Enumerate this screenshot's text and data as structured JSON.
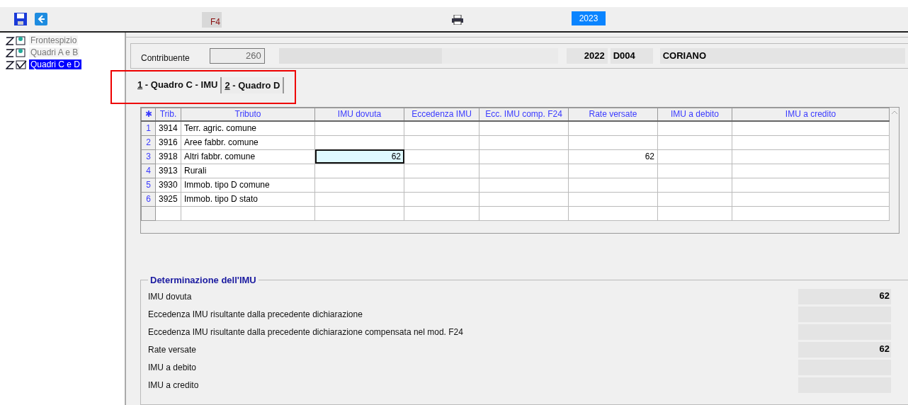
{
  "toolbar": {
    "shortcut_key": "F4",
    "year": "2023"
  },
  "sidebar": {
    "items": [
      {
        "label": "Frontespizio",
        "kind": "pending",
        "selected": false
      },
      {
        "label": "Quadri A e B",
        "kind": "pending",
        "selected": false
      },
      {
        "label": "Quadri C e D",
        "kind": "done",
        "selected": true
      }
    ]
  },
  "header": {
    "contribuente_label": "Contribuente",
    "contribuente_value": "260",
    "year": "2022",
    "code": "D004",
    "municipality": "CORIANO"
  },
  "tabs": [
    {
      "key": "1",
      "label": " - Quadro C - IMU",
      "selected": true
    },
    {
      "key": "2",
      "label": " - Quadro D",
      "selected": false
    }
  ],
  "table": {
    "corner": "✱",
    "columns": [
      "Trib.",
      "Tributo",
      "IMU dovuta",
      "Eccedenza IMU",
      "Ecc. IMU comp. F24",
      "Rate versate",
      "IMU a debito",
      "IMU a credito"
    ],
    "rows": [
      {
        "num": "1",
        "cells": [
          {
            "value": "3914",
            "selected": false
          },
          {
            "value": "Terr. agric. comune",
            "selected": false
          },
          {
            "selected": false
          },
          {
            "selected": false
          },
          {
            "selected": false
          },
          {
            "selected": false
          },
          {
            "selected": false
          },
          {
            "selected": false
          }
        ]
      },
      {
        "num": "2",
        "cells": [
          {
            "value": "3916",
            "selected": false
          },
          {
            "value": "Aree fabbr. comune",
            "selected": false
          },
          {
            "selected": false
          },
          {
            "selected": false
          },
          {
            "selected": false
          },
          {
            "selected": false
          },
          {
            "selected": false
          },
          {
            "selected": false
          }
        ]
      },
      {
        "num": "3",
        "cells": [
          {
            "value": "3918",
            "selected": false
          },
          {
            "value": "Altri fabbr. comune",
            "selected": false
          },
          {
            "value": "62",
            "selected": true
          },
          {
            "selected": false
          },
          {
            "selected": false
          },
          {
            "value": "62",
            "selected": false
          },
          {
            "selected": false
          },
          {
            "selected": false
          }
        ]
      },
      {
        "num": "4",
        "cells": [
          {
            "value": "3913",
            "selected": false
          },
          {
            "value": "Rurali",
            "selected": false
          },
          {
            "selected": false
          },
          {
            "selected": false
          },
          {
            "selected": false
          },
          {
            "selected": false
          },
          {
            "selected": false
          },
          {
            "selected": false
          }
        ]
      },
      {
        "num": "5",
        "cells": [
          {
            "value": "3930",
            "selected": false
          },
          {
            "value": "Immob. tipo D comune",
            "selected": false
          },
          {
            "selected": false
          },
          {
            "selected": false
          },
          {
            "selected": false
          },
          {
            "selected": false
          },
          {
            "selected": false
          },
          {
            "selected": false
          }
        ]
      },
      {
        "num": "6",
        "cells": [
          {
            "value": "3925",
            "selected": false
          },
          {
            "value": "Immob. tipo D stato",
            "selected": false
          },
          {
            "selected": false
          },
          {
            "selected": false
          },
          {
            "selected": false
          },
          {
            "selected": false
          },
          {
            "selected": false
          },
          {
            "selected": false
          }
        ]
      },
      {
        "cells": [
          {
            "selected": false
          },
          {
            "selected": false
          },
          {
            "selected": false
          },
          {
            "selected": false
          },
          {
            "selected": false
          },
          {
            "selected": false
          },
          {
            "selected": false
          },
          {
            "selected": false
          }
        ]
      }
    ]
  },
  "summary": {
    "title": "Determinazione dell'IMU",
    "items": [
      {
        "label": "IMU dovuta",
        "value": "62"
      },
      {
        "label": "Eccedenza IMU risultante dalla precedente dichiarazione"
      },
      {
        "label": "Eccedenza IMU risultante dalla precedente dichiarazione compensata nel mod. F24"
      },
      {
        "label": "Rate versate",
        "value": "62"
      },
      {
        "label": "IMU a debito"
      },
      {
        "label": "IMU a credito"
      }
    ]
  }
}
